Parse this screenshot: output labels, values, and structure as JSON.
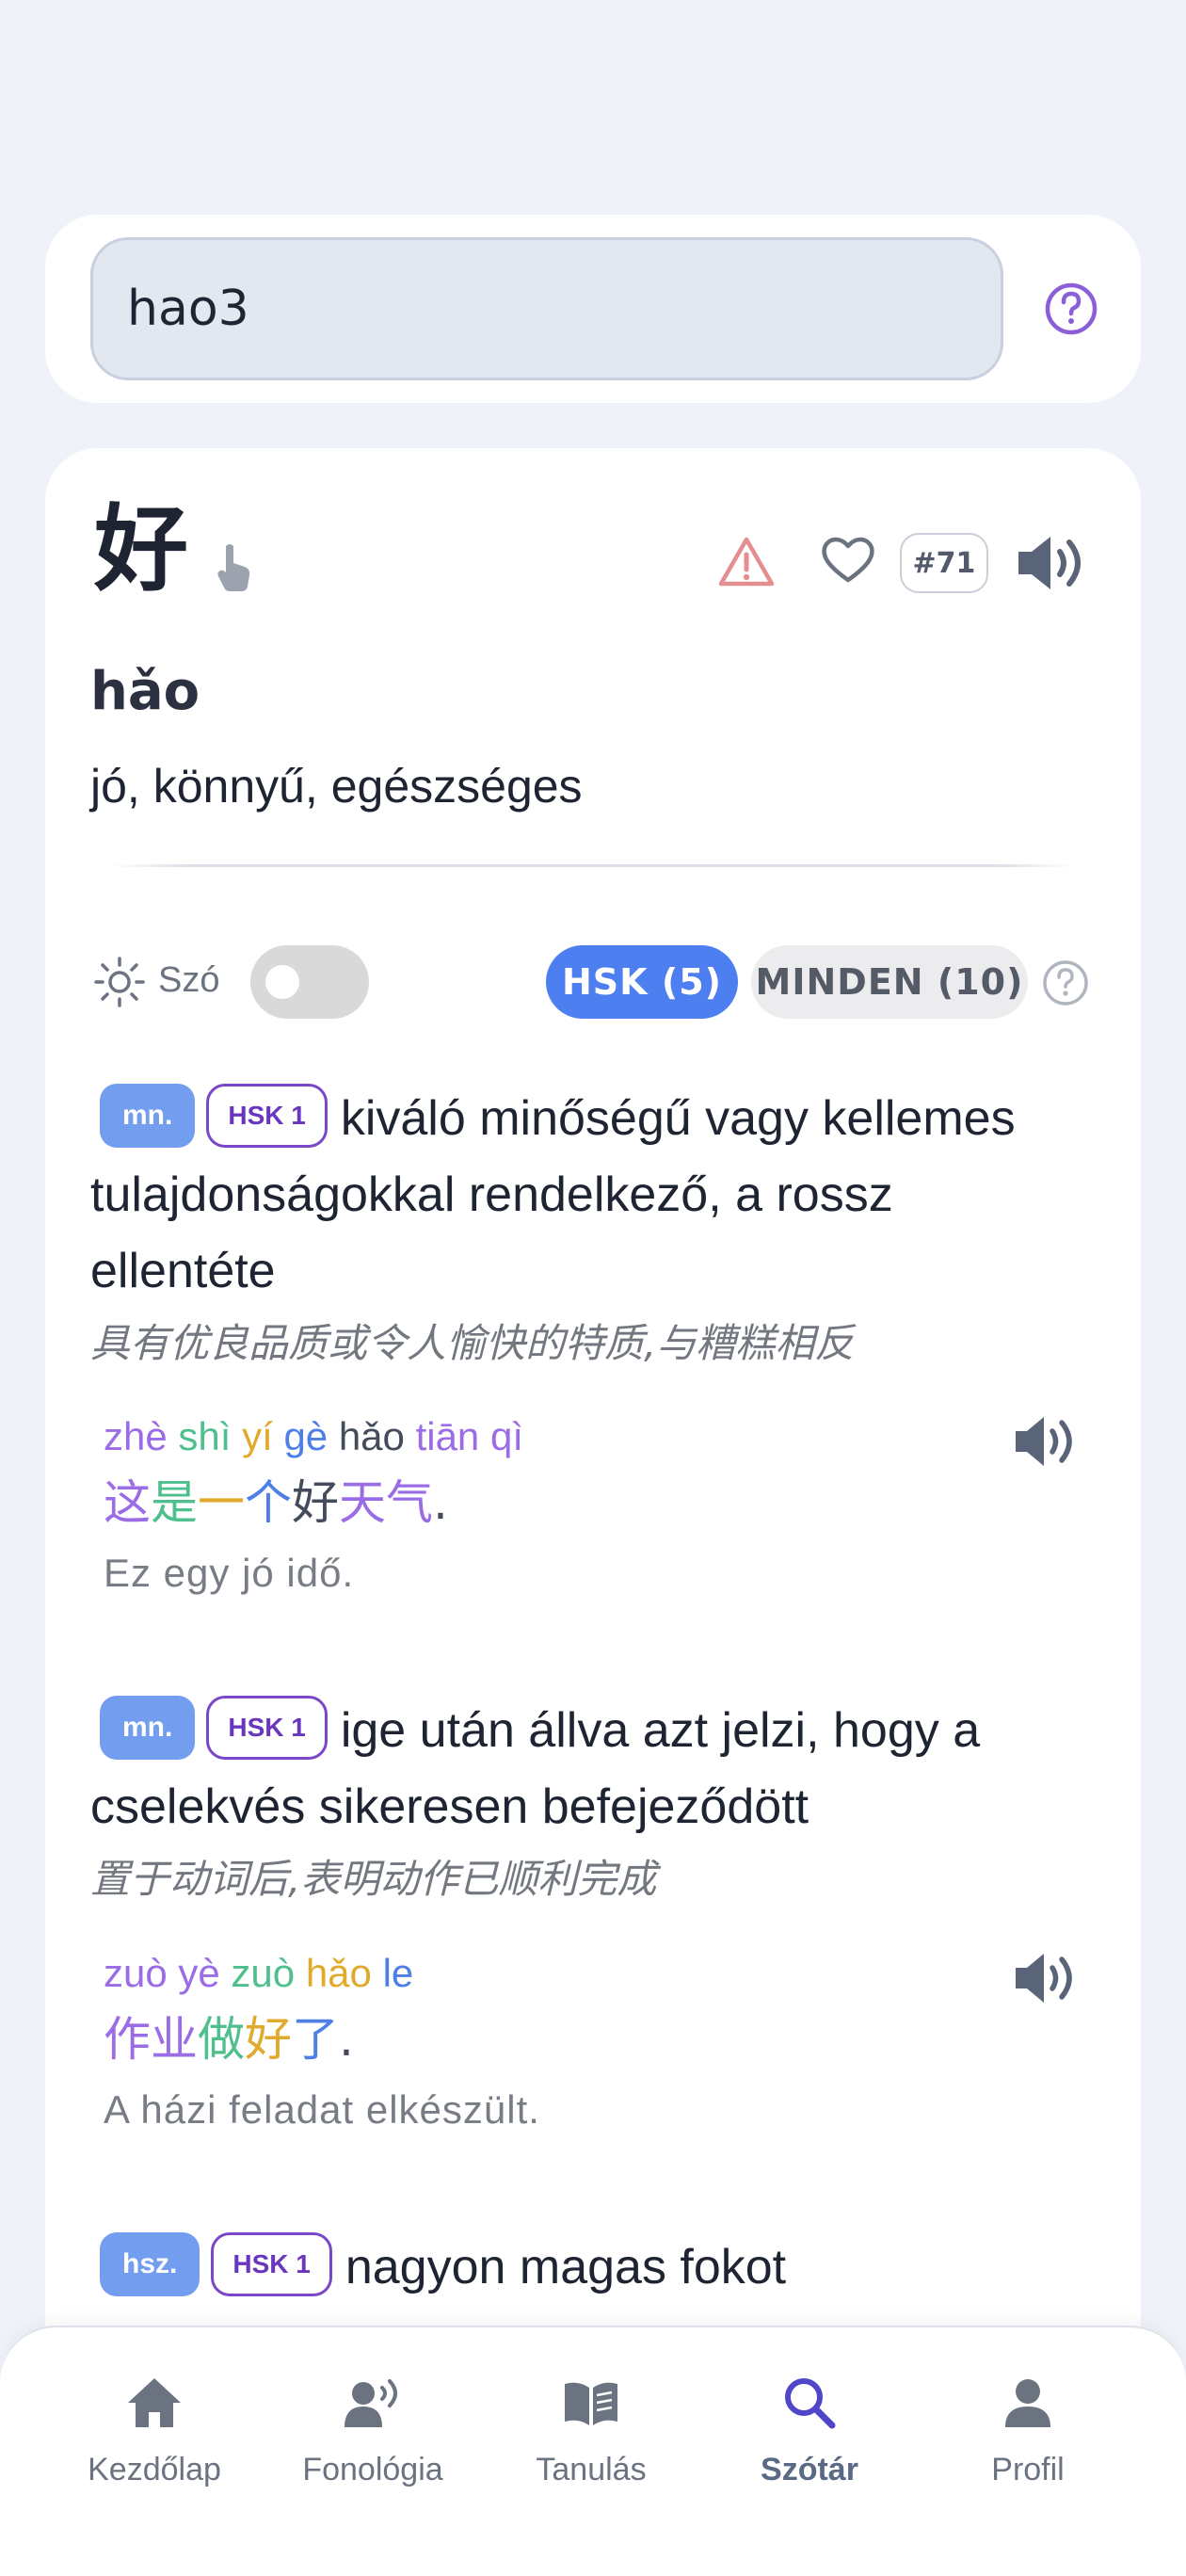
{
  "search": {
    "value": "hao3"
  },
  "entry": {
    "hanzi": "好",
    "rank": "#71",
    "pinyin": "hǎo",
    "meaning": "jó, könnyű, egészséges"
  },
  "filters": {
    "word_label": "Szó",
    "tab_hsk": "HSK (5)",
    "tab_all": "MINDEN (10)"
  },
  "definitions": [
    {
      "pos": "mn.",
      "hsk": "HSK 1",
      "text_first": "kiváló minőségű vagy kellemes",
      "text_rest": [
        "tulajdonságokkal rendelkező, a rossz",
        "ellentéte"
      ],
      "chinese": "具有优良品质或令人愉快的特质,与糟糕相反",
      "example": {
        "pinyin": [
          "zhè",
          "shì",
          "yí",
          "gè",
          "hǎo",
          "tiān",
          "qì"
        ],
        "hanzi": [
          "这",
          "是",
          "一",
          "个",
          "好",
          "天",
          "气",
          "."
        ],
        "translation": "Ez egy jó idő."
      }
    },
    {
      "pos": "mn.",
      "hsk": "HSK 1",
      "text_first": "ige után állva azt jelzi, hogy a",
      "text_rest": [
        "cselekvés sikeresen befejeződött"
      ],
      "chinese": "置于动词后,表明动作已顺利完成",
      "example": {
        "pinyin": [
          "zuò",
          "yè",
          "zuò",
          "hǎo",
          "le"
        ],
        "hanzi": [
          "作",
          "业",
          "做",
          "好",
          "了",
          "."
        ],
        "translation": "A házi feladat elkészült."
      }
    },
    {
      "pos": "hsz.",
      "hsk": "HSK 1",
      "text_first": "nagyon magas fokot"
    }
  ],
  "colors": {
    "accent": "#4d7ff0",
    "purple": "#9a6ce6",
    "green": "#4fbf8d",
    "yellow": "#e0aa2c",
    "blue": "#4d7fe6"
  },
  "nav": {
    "home": "Kezdőlap",
    "phonology": "Fonológia",
    "learning": "Tanulás",
    "dictionary": "Szótár",
    "profile": "Profil"
  }
}
